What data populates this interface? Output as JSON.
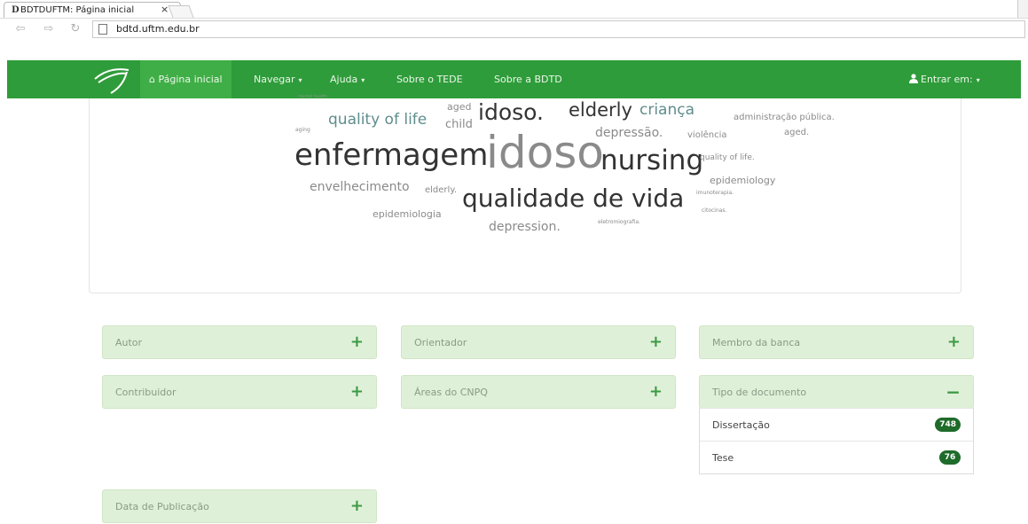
{
  "browser": {
    "tab_title": "BDTDUFTM: Página inicial",
    "tab_favicon": "D",
    "tab_close": "×",
    "url": "bdtd.uftm.edu.br"
  },
  "nav": {
    "home_label": "Página inicial",
    "browse_label": "Navegar",
    "help_label": "Ajuda",
    "about_tede_label": "Sobre o TEDE",
    "about_bdtd_label": "Sobre a BDTD",
    "login_label": "Entrar em:",
    "caret": "▾",
    "home_icon": "⌂",
    "user_icon": "user-icon",
    "accent_color": "#2e9c3a"
  },
  "word_cloud": {
    "words": [
      {
        "text": "idoso",
        "color": "#8a8a8a"
      },
      {
        "text": "enfermagem",
        "color": "#333333"
      },
      {
        "text": "nursing",
        "color": "#333333"
      },
      {
        "text": "qualidade de vida",
        "color": "#333333"
      },
      {
        "text": "idoso.",
        "color": "#333333"
      },
      {
        "text": "elderly",
        "color": "#333333"
      },
      {
        "text": "criança",
        "color": "#5f8d8d"
      },
      {
        "text": "quality of life",
        "color": "#5f8d8d"
      },
      {
        "text": "depressão.",
        "color": "#8a8a8a"
      },
      {
        "text": "depression.",
        "color": "#8a8a8a"
      },
      {
        "text": "envelhecimento",
        "color": "#8a8a8a"
      },
      {
        "text": "child",
        "color": "#8a8a8a"
      },
      {
        "text": "aged",
        "color": "#8a8a8a"
      },
      {
        "text": "administração pública.",
        "color": "#8a8a8a"
      },
      {
        "text": "aged.",
        "color": "#8a8a8a"
      },
      {
        "text": "violência",
        "color": "#8a8a8a"
      },
      {
        "text": "quality of life.",
        "color": "#8a8a8a"
      },
      {
        "text": "epidemiology",
        "color": "#8a8a8a"
      },
      {
        "text": "epidemiologia",
        "color": "#8a8a8a"
      },
      {
        "text": "elderly.",
        "color": "#8a8a8a"
      },
      {
        "text": "aging",
        "color": "#8a8a8a"
      },
      {
        "text": "imunoterapia.",
        "color": "#8a8a8a"
      },
      {
        "text": "citocinas.",
        "color": "#8a8a8a"
      },
      {
        "text": "eletromiografia.",
        "color": "#8a8a8a"
      }
    ]
  },
  "facets": {
    "autor": {
      "label": "Autor",
      "toggle": "+"
    },
    "orientador": {
      "label": "Orientador",
      "toggle": "+"
    },
    "membro_banca": {
      "label": "Membro da banca",
      "toggle": "+"
    },
    "contribuidor": {
      "label": "Contribuidor",
      "toggle": "+"
    },
    "areas_cnpq": {
      "label": "Áreas do CNPQ",
      "toggle": "+"
    },
    "tipo_documento": {
      "label": "Tipo de documento",
      "toggle": "−",
      "items": [
        {
          "label": "Dissertação",
          "count": "748"
        },
        {
          "label": "Tese",
          "count": "76"
        }
      ]
    },
    "data_publicacao": {
      "label": "Data de Publicação",
      "toggle": "+"
    }
  }
}
